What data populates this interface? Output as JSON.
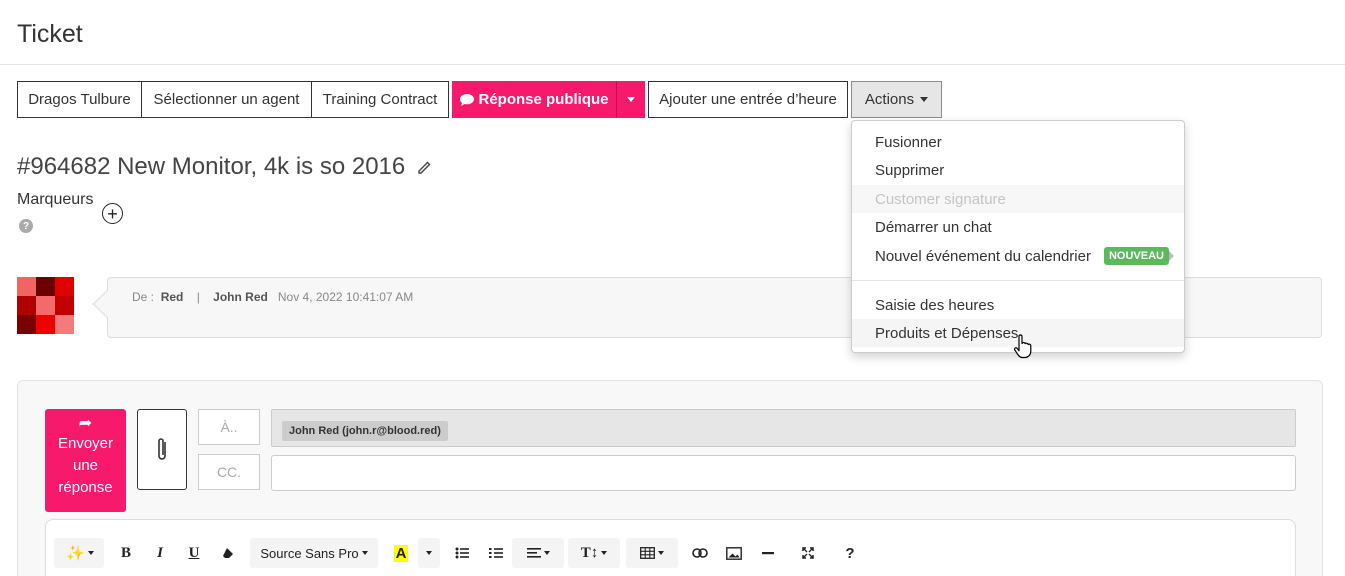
{
  "page": {
    "title": "Ticket"
  },
  "toolbar": {
    "customer_label": "Dragos Tulbure",
    "agent_label": "Sélectionner un agent",
    "contract_label": "Training Contract",
    "public_reply_label": "Réponse publique",
    "time_entry_label": "Ajouter une entrée d’heure",
    "actions_label": "Actions"
  },
  "actions_menu": {
    "items": [
      {
        "label": "Fusionner",
        "disabled": false
      },
      {
        "label": "Supprimer",
        "disabled": false
      },
      {
        "label": "Customer signature",
        "disabled": true
      },
      {
        "label": "Démarrer un chat",
        "disabled": false
      },
      {
        "label": "Nouvel événement du calendrier",
        "disabled": false,
        "badge": "NOUVEAU"
      },
      {
        "label": "Saisie des heures",
        "disabled": false
      },
      {
        "label": "Produits et Dépenses",
        "disabled": false
      }
    ]
  },
  "ticket": {
    "title": "#964682 New Monitor, 4k is so 2016",
    "tags_label": "Marqueurs",
    "help_glyph": "?"
  },
  "message": {
    "from_label": "De :",
    "from_name": "Red",
    "separator": "|",
    "author": "John Red",
    "timestamp": "Nov 4, 2022 10:41:07 AM"
  },
  "avatar_colors": [
    "#f26464",
    "#6b0000",
    "#e00000",
    "#b00000",
    "#f36a6a",
    "#c20000",
    "#7a0000",
    "#ee0000",
    "#f47b7b"
  ],
  "reply": {
    "send_label": "Envoyer une réponse",
    "to_label": "À..",
    "cc_label": "CC.",
    "recipient": "John Red (john.r@blood.red)"
  },
  "editor": {
    "font_name": "Source Sans Pro",
    "bold": "B",
    "italic": "I",
    "underline": "U",
    "highlight": "A",
    "text_size": "T↕",
    "help": "?"
  },
  "colors": {
    "accent": "#f7196c",
    "badge": "#5cb85c"
  }
}
